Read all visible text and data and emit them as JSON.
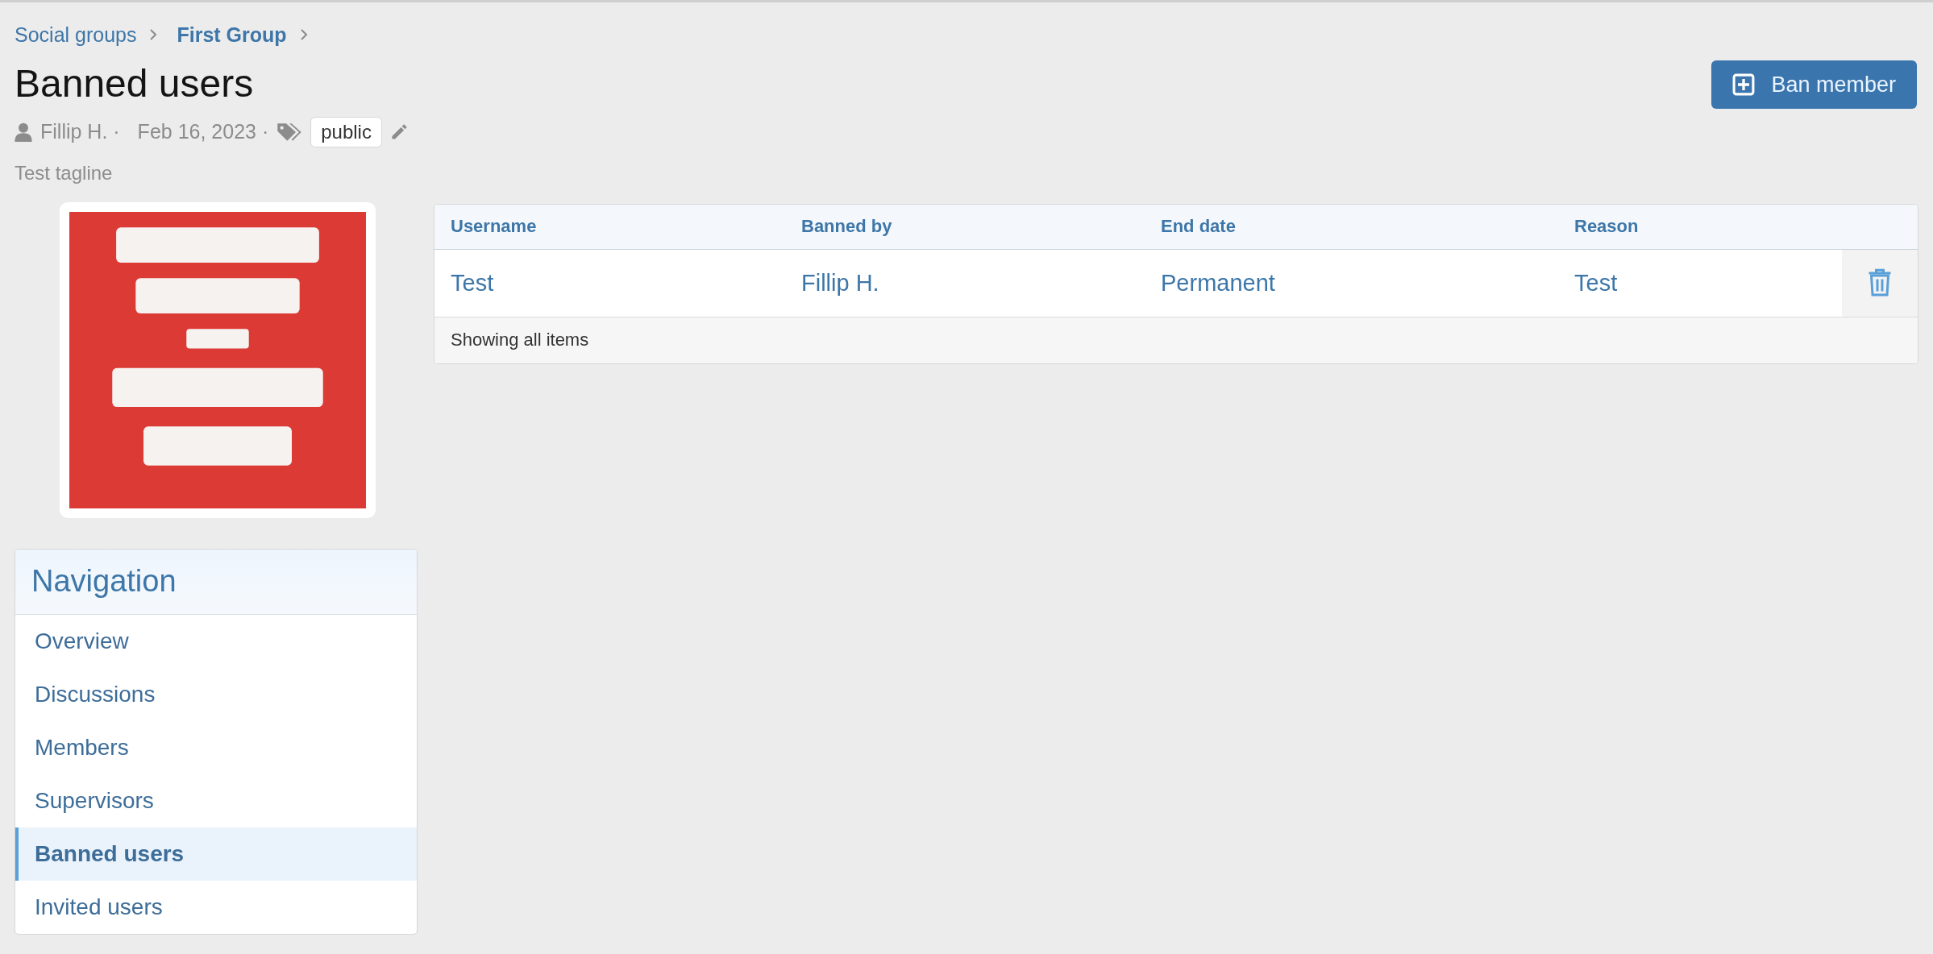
{
  "breadcrumb": [
    {
      "label": "Social groups",
      "current": false
    },
    {
      "label": "First Group",
      "current": true
    }
  ],
  "title": "Banned users",
  "meta": {
    "author": "Fillip H. ·",
    "date": "Feb 16, 2023 ·",
    "tag": "public"
  },
  "tagline": "Test tagline",
  "action_button": "Ban member",
  "navigation": {
    "title": "Navigation",
    "items": [
      {
        "label": "Overview",
        "selected": false
      },
      {
        "label": "Discussions",
        "selected": false
      },
      {
        "label": "Members",
        "selected": false
      },
      {
        "label": "Supervisors",
        "selected": false
      },
      {
        "label": "Banned users",
        "selected": true
      },
      {
        "label": "Invited users",
        "selected": false
      }
    ]
  },
  "table": {
    "columns": [
      "Username",
      "Banned by",
      "End date",
      "Reason"
    ],
    "rows": [
      {
        "cells": [
          "Test",
          "Fillip H.",
          "Permanent",
          "Test"
        ]
      }
    ],
    "footer": "Showing all items"
  }
}
